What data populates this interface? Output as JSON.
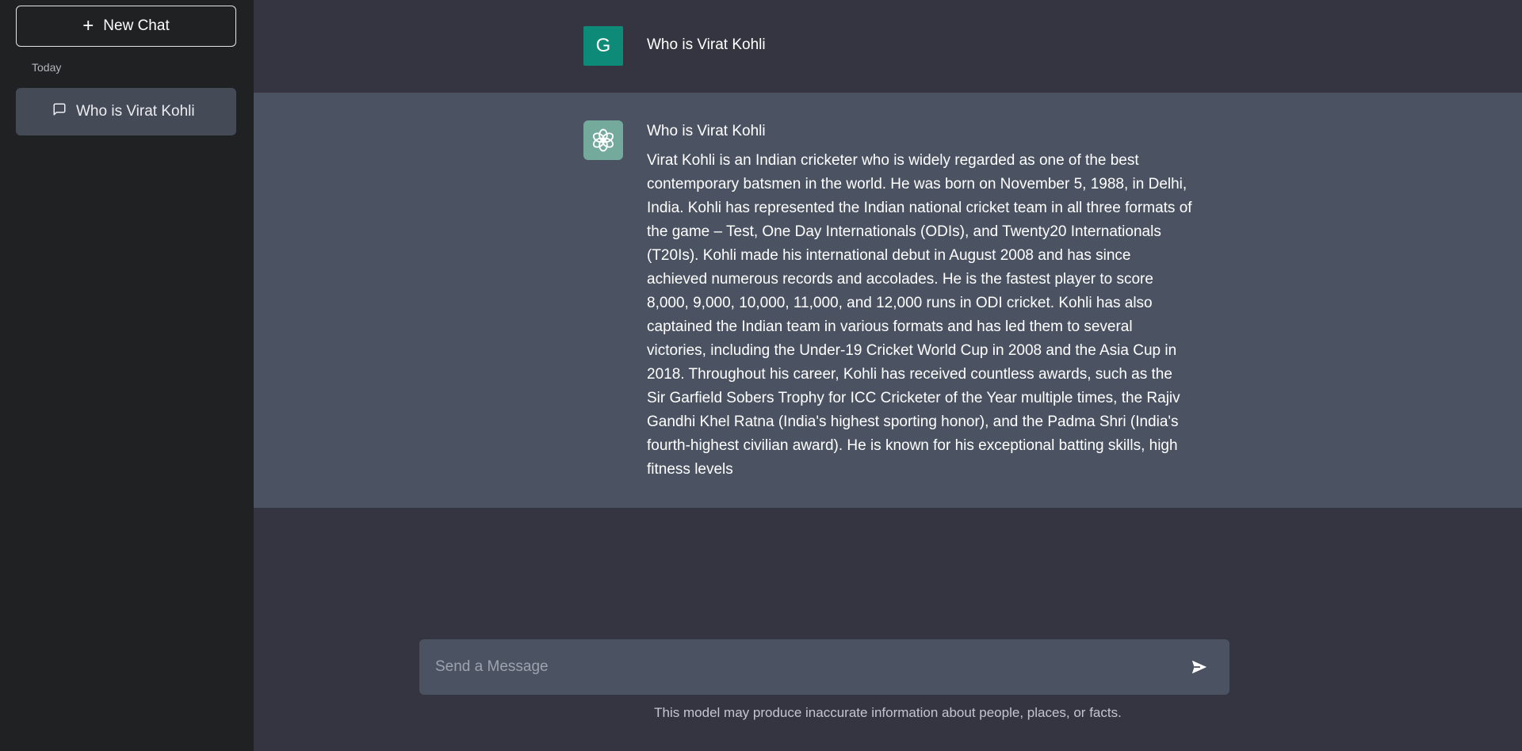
{
  "sidebar": {
    "new_chat_label": "New Chat",
    "section_label": "Today",
    "history": [
      {
        "label": "Who is Virat Kohli"
      }
    ]
  },
  "conversation": {
    "user_message": {
      "avatar_letter": "G",
      "text": "Who is Virat Kohli"
    },
    "assistant_message": {
      "heading": "Who is Virat Kohli",
      "body": "Virat Kohli is an Indian cricketer who is widely regarded as one of the best contemporary batsmen in the world. He was born on November 5, 1988, in Delhi, India. Kohli has represented the Indian national cricket team in all three formats of the game – Test, One Day Internationals (ODIs), and Twenty20 Internationals (T20Is). Kohli made his international debut in August 2008 and has since achieved numerous records and accolades. He is the fastest player to score 8,000, 9,000, 10,000, 11,000, and 12,000 runs in ODI cricket. Kohli has also captained the Indian team in various formats and has led them to several victories, including the Under-19 Cricket World Cup in 2008 and the Asia Cup in 2018. Throughout his career, Kohli has received countless awards, such as the Sir Garfield Sobers Trophy for ICC Cricketer of the Year multiple times, the Rajiv Gandhi Khel Ratna (India's highest sporting honor), and the Padma Shri (India's fourth-highest civilian award). He is known for his exceptional batting skills, high fitness levels"
    }
  },
  "composer": {
    "placeholder": "Send a Message",
    "value": ""
  },
  "disclaimer": "This model may produce inaccurate information about people, places, or facts.",
  "colors": {
    "sidebar_bg": "#202123",
    "main_bg": "#343541",
    "assistant_row_bg": "#4b5362",
    "user_avatar_bg": "#0e8a78",
    "assistant_avatar_bg": "#74aa9c"
  },
  "icons": {
    "new_chat": "plus-icon",
    "history_item": "chat-bubble-icon",
    "assistant_avatar": "openai-logo-icon",
    "send": "send-icon"
  }
}
